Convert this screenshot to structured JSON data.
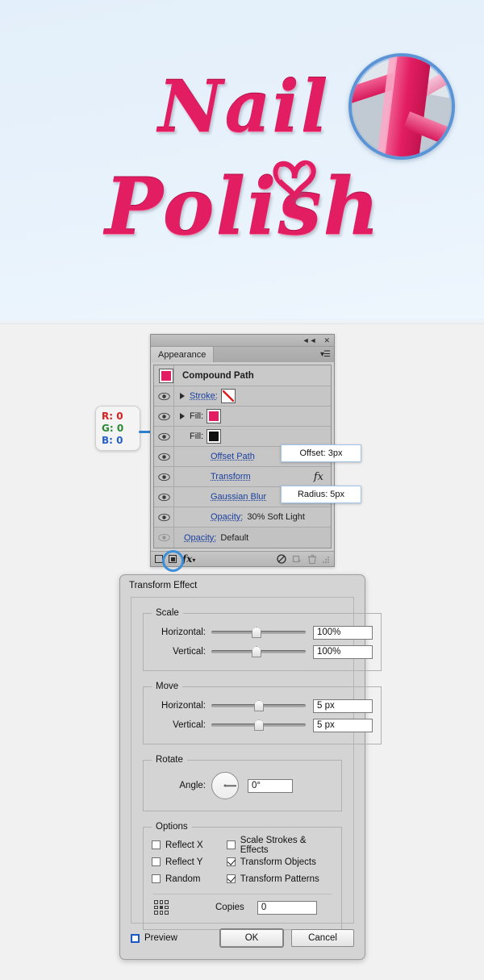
{
  "artwork": {
    "line1": "Nail",
    "line2": "Polish",
    "heart_icon": "heart-swash",
    "magnifier_icon": "magnifier-detail",
    "background_color": "#e6f1fb",
    "pink_color": "#e31d62",
    "magnifier_border_color": "#5b94d6"
  },
  "appearance_panel": {
    "tab_label": "Appearance",
    "collapse_icon": "collapse-double-arrow-icon",
    "close_icon": "close-icon",
    "menu_icon": "panel-menu-icon",
    "target": {
      "title": "Compound Path",
      "swatch_color": "#e31d62"
    },
    "rows": [
      {
        "label": "Stroke:",
        "value": "",
        "swatch": "none",
        "has_disclosure": true,
        "visible": true,
        "indent": false
      },
      {
        "label": "Fill:",
        "value": "",
        "swatch": "pink",
        "has_disclosure": true,
        "visible": true,
        "indent": false
      },
      {
        "label": "Fill:",
        "value": "",
        "swatch": "black",
        "has_disclosure": false,
        "visible": true,
        "indent": false
      },
      {
        "label": "Offset Path",
        "value": "",
        "swatch": null,
        "has_disclosure": false,
        "visible": true,
        "indent": true
      },
      {
        "label": "Transform",
        "value": "fx",
        "swatch": null,
        "has_disclosure": false,
        "visible": true,
        "indent": true
      },
      {
        "label": "Gaussian Blur",
        "value": "",
        "swatch": null,
        "has_disclosure": false,
        "visible": true,
        "indent": true
      },
      {
        "label": "Opacity:",
        "value": "30% Soft Light",
        "swatch": null,
        "has_disclosure": false,
        "visible": true,
        "indent": true
      },
      {
        "label": "Opacity:",
        "value": "Default",
        "swatch": null,
        "has_disclosure": false,
        "visible": false,
        "indent": false
      }
    ],
    "footer": {
      "new_art_icon": "new-art-has-basic-appearance-icon",
      "clear_appearance_icon": "clear-appearance-icon",
      "duplicate_icon": "duplicate-item-icon",
      "delete_icon": "trash-icon",
      "fx_label": "fx",
      "resize_grip_icon": "resize-grip-icon"
    },
    "callouts": {
      "offset": "Offset: 3px",
      "radius": "Radius: 5px"
    }
  },
  "rgb_callout": {
    "r": "R: 0",
    "g": "G: 0",
    "b": "B: 0"
  },
  "transform_dialog": {
    "title": "Transform Effect",
    "scale": {
      "legend": "Scale",
      "horizontal_label": "Horizontal:",
      "horizontal_value": "100%",
      "vertical_label": "Vertical:",
      "vertical_value": "100%"
    },
    "move": {
      "legend": "Move",
      "horizontal_label": "Horizontal:",
      "horizontal_value": "5 px",
      "vertical_label": "Vertical:",
      "vertical_value": "5 px"
    },
    "rotate": {
      "legend": "Rotate",
      "angle_label": "Angle:",
      "angle_value": "0°",
      "dial_icon": "angle-dial-icon"
    },
    "options": {
      "legend": "Options",
      "reflect_x": {
        "label": "Reflect X",
        "checked": false
      },
      "reflect_y": {
        "label": "Reflect Y",
        "checked": false
      },
      "random": {
        "label": "Random",
        "checked": false
      },
      "scale_strokes": {
        "label": "Scale Strokes & Effects",
        "checked": false
      },
      "transform_objects": {
        "label": "Transform Objects",
        "checked": true
      },
      "transform_patterns": {
        "label": "Transform Patterns",
        "checked": true
      },
      "copies_label": "Copies",
      "copies_value": "0",
      "reference_point_icon": "reference-point-grid-icon"
    },
    "footer": {
      "preview_label": "Preview",
      "preview_checked": false,
      "ok_label": "OK",
      "cancel_label": "Cancel"
    }
  }
}
